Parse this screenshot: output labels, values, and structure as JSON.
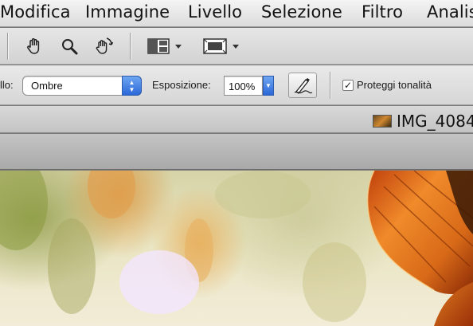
{
  "menubar": {
    "items": [
      "Modifica",
      "Immagine",
      "Livello",
      "Selezione",
      "Filtro",
      "Analisi"
    ]
  },
  "tools": {
    "items": [
      "hand-tool",
      "zoom-tool",
      "rotate-view-tool",
      "arrange-documents",
      "screen-mode"
    ]
  },
  "options": {
    "range_label": "llo:",
    "range_value": "Ombre",
    "exposure_label": "Esposizione:",
    "exposure_value": "100%",
    "protect_tones_label": "Proteggi tonalità",
    "protect_tones_checked": "✓"
  },
  "document": {
    "title": "IMG_4084"
  },
  "colors": {
    "accent": "#2a68d8",
    "leaf": "#d86a18"
  }
}
